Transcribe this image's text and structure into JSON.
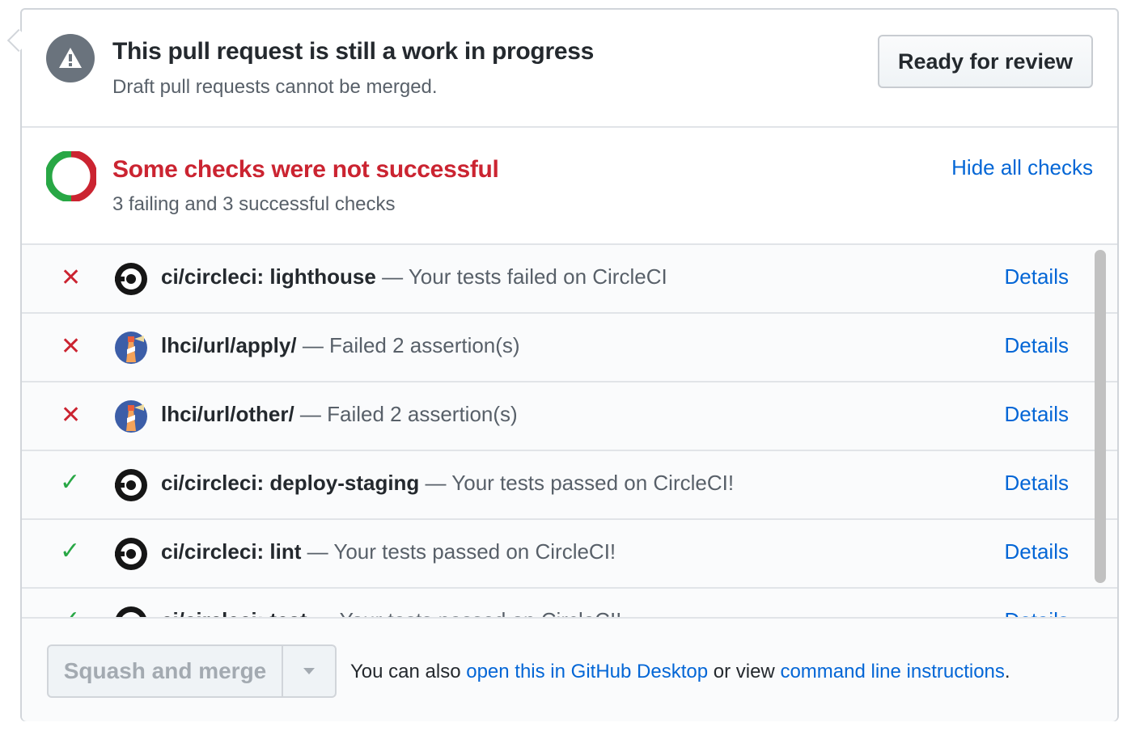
{
  "draft": {
    "title": "This pull request is still a work in progress",
    "subtitle": "Draft pull requests cannot be merged.",
    "ready_button": "Ready for review",
    "icon": "alert-icon"
  },
  "checks_summary": {
    "title": "Some checks were not successful",
    "subtitle": "3 failing and 3 successful checks",
    "hide_link": "Hide all checks",
    "colors": {
      "failing": "#cb2431",
      "success": "#28a745"
    }
  },
  "checks": [
    {
      "status": "failed",
      "status_glyph": "✕",
      "app": "circleci",
      "name": "ci/circleci: lighthouse",
      "description": "— Your tests failed on CircleCI",
      "details": "Details"
    },
    {
      "status": "failed",
      "status_glyph": "✕",
      "app": "lighthouse-ci",
      "name": "lhci/url/apply/",
      "description": "— Failed 2 assertion(s)",
      "details": "Details"
    },
    {
      "status": "failed",
      "status_glyph": "✕",
      "app": "lighthouse-ci",
      "name": "lhci/url/other/",
      "description": "— Failed 2 assertion(s)",
      "details": "Details"
    },
    {
      "status": "success",
      "status_glyph": "✓",
      "app": "circleci",
      "name": "ci/circleci: deploy-staging",
      "description": "— Your tests passed on CircleCI!",
      "details": "Details"
    },
    {
      "status": "success",
      "status_glyph": "✓",
      "app": "circleci",
      "name": "ci/circleci: lint",
      "description": "— Your tests passed on CircleCI!",
      "details": "Details"
    },
    {
      "status": "success",
      "status_glyph": "✓",
      "app": "circleci",
      "name": "ci/circleci: test",
      "description": "— Your tests passed on CircleCI!",
      "details": "Details"
    }
  ],
  "merge": {
    "button_label": "Squash and merge",
    "text_prefix": "You can also",
    "desktop_link": "open this in GitHub Desktop",
    "text_middle": "or view",
    "cli_link": "command line instructions",
    "text_suffix": "."
  }
}
